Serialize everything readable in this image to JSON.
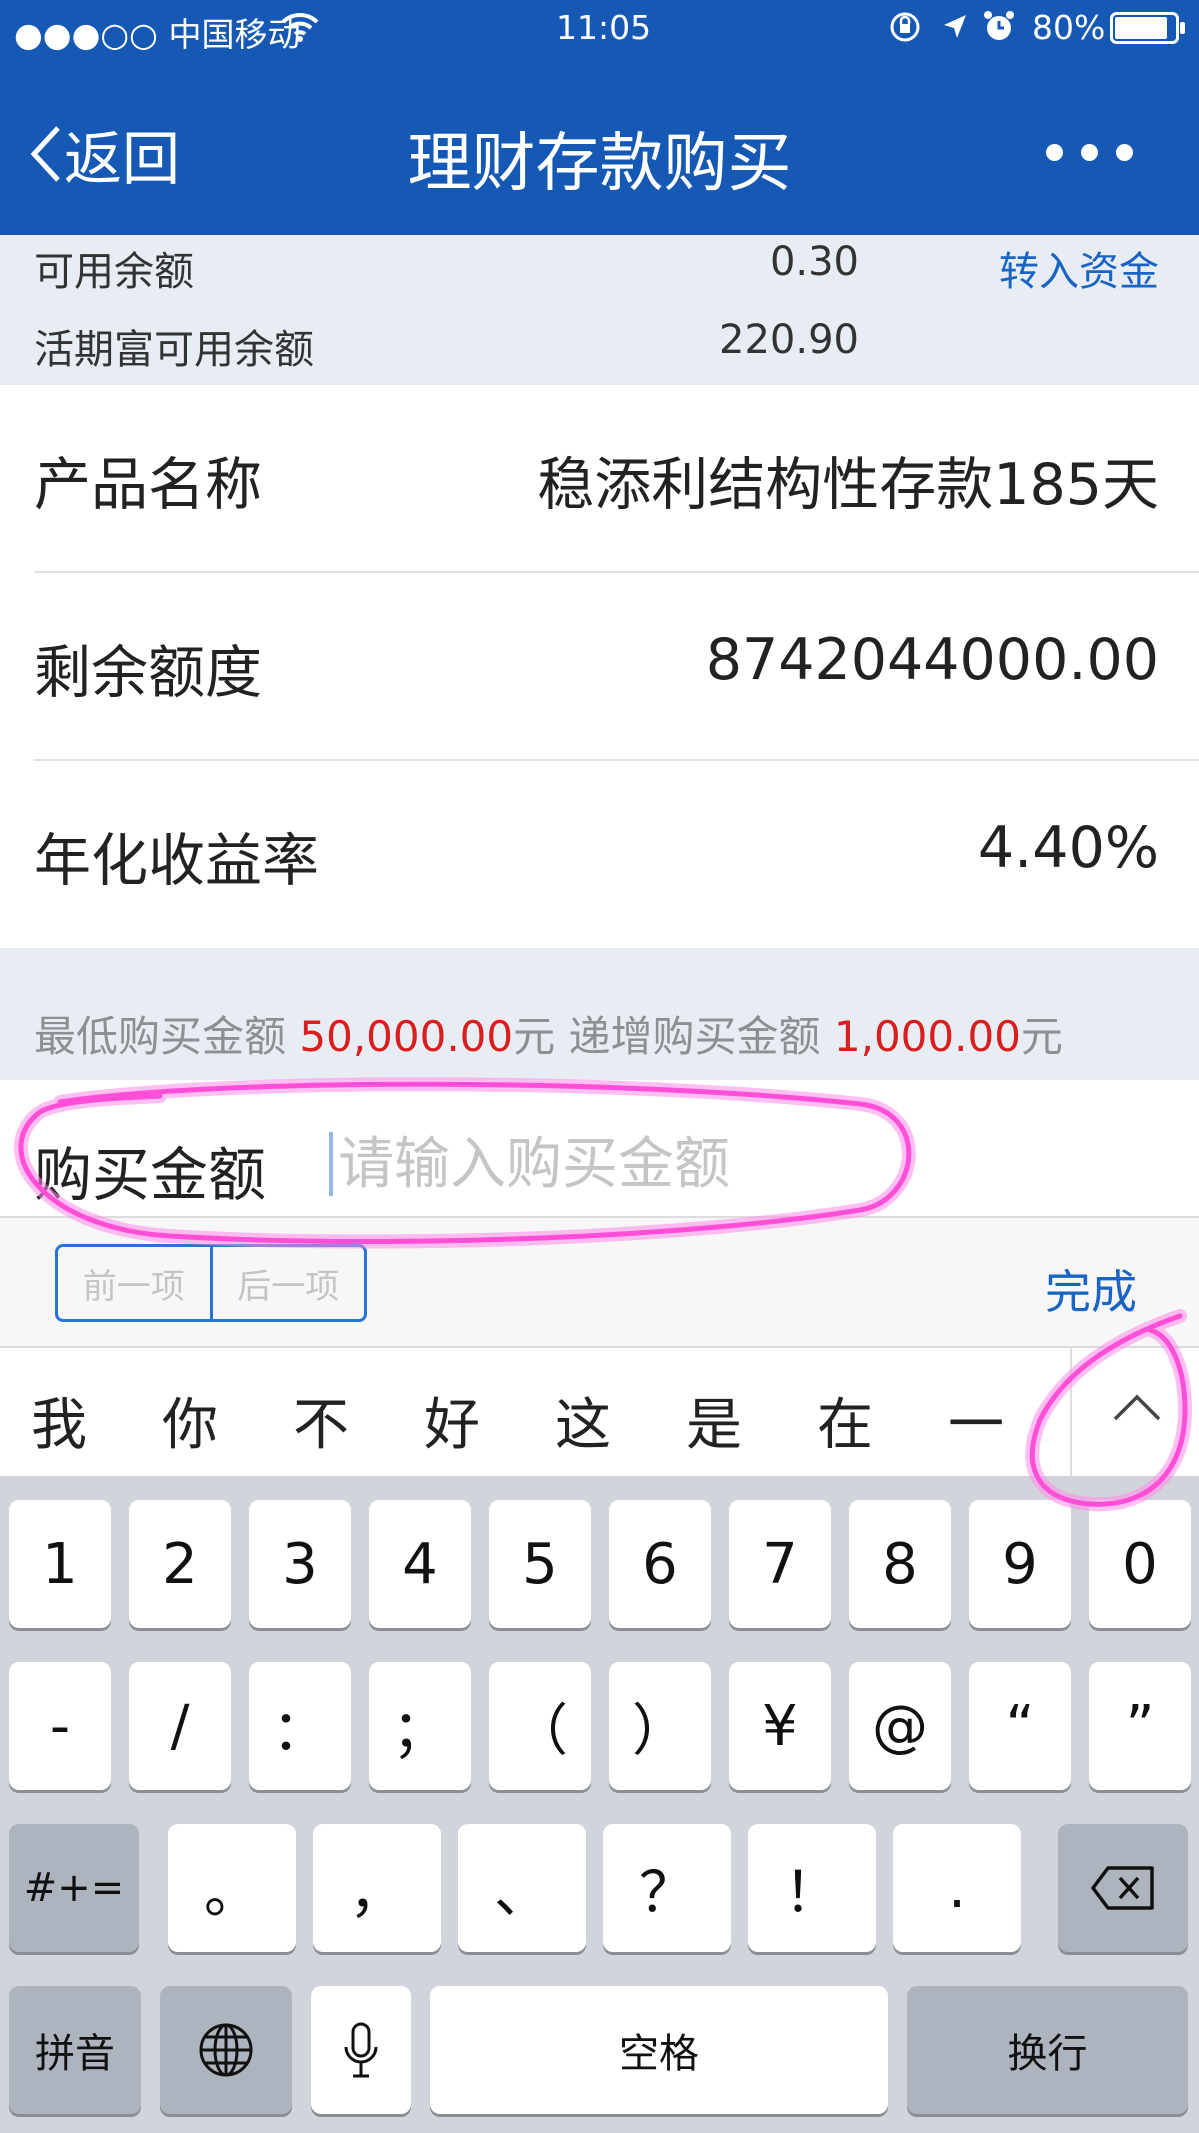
{
  "status_bar": {
    "carrier": "●●●○○ 中国移动",
    "time": "11:05",
    "battery": "80%",
    "icons": [
      "wifi-icon",
      "orientation-lock-icon",
      "location-arrow-icon",
      "alarm-icon",
      "battery-icon"
    ]
  },
  "nav": {
    "back_label": "返回",
    "title": "理财存款购买",
    "more_icon": "more-dots-icon"
  },
  "balances": {
    "available_label": "可用余额",
    "available_value": "0.30",
    "transfer_link": "转入资金",
    "current_label": "活期富可用余额",
    "current_value": "220.90"
  },
  "product": {
    "name_label": "产品名称",
    "name_value": "稳添利结构性存款185天",
    "quota_label": "剩余额度",
    "quota_value": "8742044000.00",
    "rate_label": "年化收益率",
    "rate_value": "4.40%"
  },
  "limits": {
    "min_label": "最低购买金额",
    "min_value": "50,000.00",
    "min_unit": "元",
    "step_label": "递增购买金额",
    "step_value": "1,000.00",
    "step_unit": "元"
  },
  "amount": {
    "label": "购买金额",
    "placeholder": "请输入购买金额",
    "value": ""
  },
  "toolbar": {
    "prev_label": "前一项",
    "next_label": "后一项",
    "done_label": "完成"
  },
  "candidates": [
    "我",
    "你",
    "不",
    "好",
    "这",
    "是",
    "在",
    "一"
  ],
  "keyboard": {
    "row1": [
      "1",
      "2",
      "3",
      "4",
      "5",
      "6",
      "7",
      "8",
      "9",
      "0"
    ],
    "row2": [
      "-",
      "/",
      "：",
      "；",
      "（",
      "）",
      "¥",
      "@",
      "“",
      "”"
    ],
    "row3": [
      "。",
      "，",
      "、",
      "？",
      "！",
      "."
    ],
    "symbols_key": "#+=",
    "pinyin_key": "拼音",
    "space_key": "空格",
    "return_key": "换行"
  },
  "colors": {
    "nav_blue": "#1559b5",
    "link_blue": "#1a64c4",
    "highlight_red": "#d81e1e",
    "annotation_pink": "#ff4fd8"
  }
}
